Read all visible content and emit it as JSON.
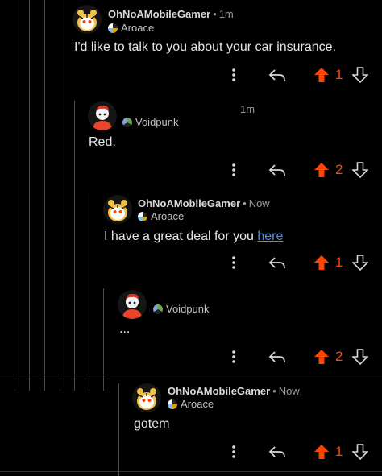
{
  "comments": [
    {
      "username": "OhNoAMobileGamer",
      "time": "1m",
      "flair": "Aroace",
      "body": "I'd like to talk to you about your car insurance.",
      "score": "1",
      "avatar": "tiger-avatar-icon"
    },
    {
      "username": "",
      "time": "1m",
      "flair": "Voidpunk",
      "body": "Red.",
      "score": "2",
      "avatar": "redhead-avatar-icon"
    },
    {
      "username": "OhNoAMobileGamer",
      "time": "Now",
      "flair": "Aroace",
      "body_prefix": "I have a great deal for you ",
      "body_link": "here",
      "score": "1",
      "avatar": "tiger-avatar-icon"
    },
    {
      "username": "",
      "time": "",
      "flair": "Voidpunk",
      "body": "...",
      "score": "2",
      "avatar": "redhead-avatar-icon"
    },
    {
      "username": "OhNoAMobileGamer",
      "time": "Now",
      "flair": "Aroace",
      "body": "gotem",
      "score": "1",
      "avatar": "tiger-avatar-icon"
    }
  ],
  "icons": {
    "more": "more-vertical-icon",
    "reply": "reply-icon",
    "upvote": "upvote-arrow-icon",
    "downvote": "downvote-arrow-icon"
  },
  "colors": {
    "upvote": "#ff4500",
    "link": "#4f8fe8",
    "background": "#000000"
  }
}
